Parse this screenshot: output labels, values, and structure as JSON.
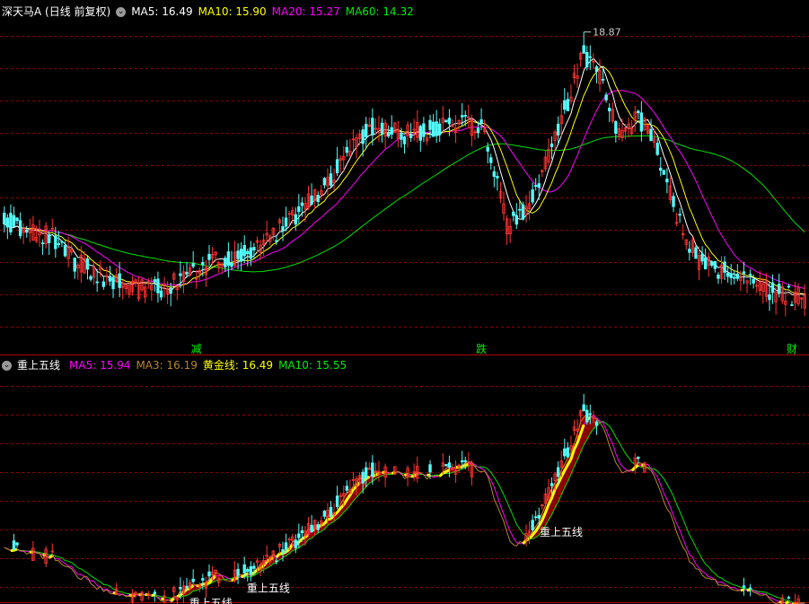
{
  "header_main": {
    "stock_title": "深天马A (日线 前复权)",
    "ma5": "MA5: 16.49",
    "ma10": "MA10: 15.90",
    "ma20": "MA20: 15.27",
    "ma60": "MA60: 14.32"
  },
  "header_sub": {
    "indicator_name": "重上五线",
    "ma5": "MA5: 15.94",
    "ma3": "MA3: 16.19",
    "golden": "黄金线: 16.49",
    "ma10": "MA10: 15.55"
  },
  "colors": {
    "bg": "#000000",
    "up": "#ff3232",
    "down": "#54fcfc",
    "grid": "#8b0000",
    "ma5": "#ffffff",
    "ma10": "#ffff00",
    "ma20": "#ff00ff",
    "ma60": "#00e000",
    "gold": "#ffff00",
    "fill": "#8b0000"
  },
  "chart_data": [
    {
      "type": "candlestick",
      "title": "深天马A (日线 前复权)",
      "ylim": [
        10.6,
        19.2
      ],
      "max_label": "18.87",
      "annotations": [
        {
          "text": "减",
          "at_bar": 60
        },
        {
          "text": "跌",
          "at_bar": 149
        },
        {
          "text": "财",
          "at_bar": 246
        }
      ]
    },
    {
      "type": "line",
      "title": "重上五线",
      "ylim": [
        12.5,
        19.5
      ],
      "signal_label": "重上五线",
      "signals": [
        {
          "text": "重上五线",
          "at_bar": 60
        },
        {
          "text": "重上五线",
          "at_bar": 78
        },
        {
          "text": "重上五线",
          "at_bar": 170
        }
      ]
    }
  ]
}
